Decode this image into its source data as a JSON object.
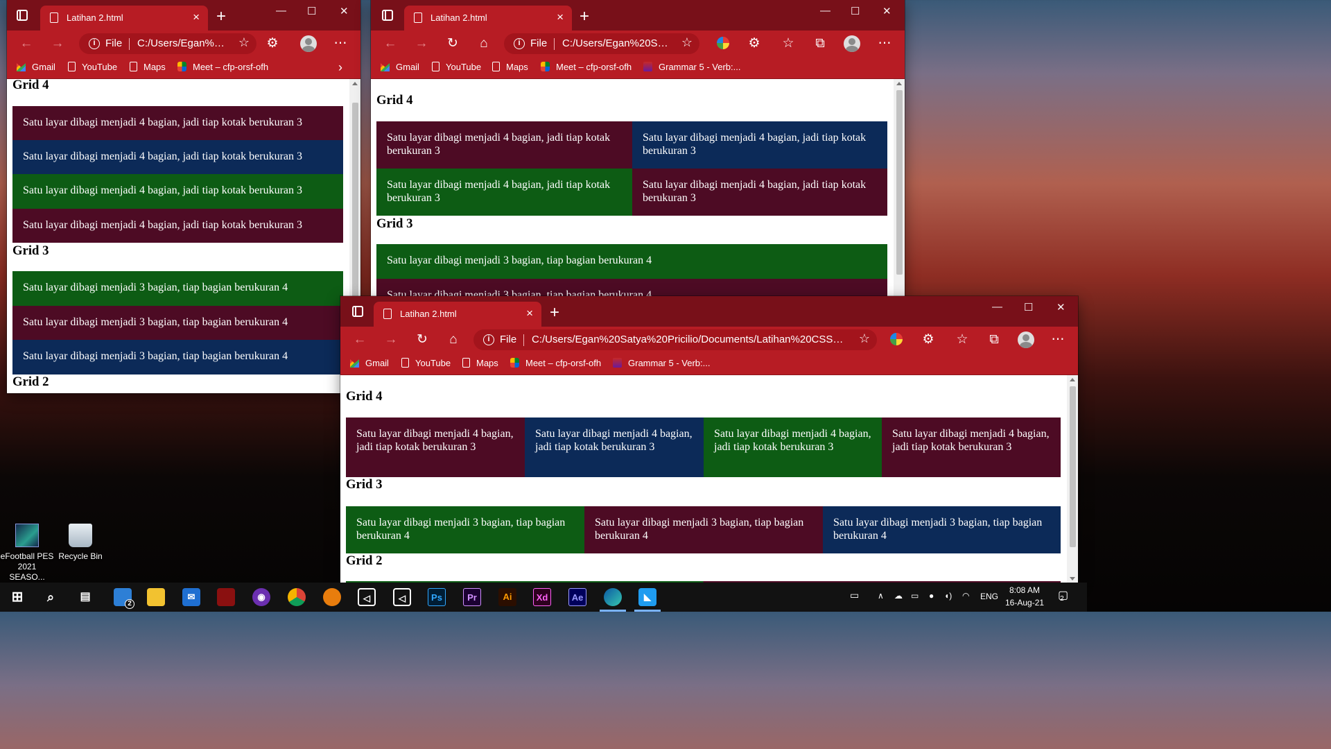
{
  "desktop": {
    "icons": [
      {
        "label_line1": "eFootball PES",
        "label_line2": "2021 SEASO..."
      },
      {
        "label_line1": "Recycle Bin",
        "label_line2": ""
      }
    ]
  },
  "browser": {
    "tab_title": "Latihan 2.html",
    "file_label": "File",
    "url_short": "C:/Users/Egan%2...",
    "url_medium": "C:/Users/Egan%20Saty...",
    "url_long": "C:/Users/Egan%20Satya%20Pricilio/Documents/Latihan%20CSS%20Re...",
    "bookmarks": [
      "Gmail",
      "YouTube",
      "Maps",
      "Meet – cfp-orsf-ofh",
      "Grammar 5 - Verb:..."
    ]
  },
  "page": {
    "heading_grid4": "Grid 4",
    "heading_grid3": "Grid 3",
    "heading_grid2": "Grid 2",
    "grid4_text": "Satu layar dibagi menjadi 4 bagian, jadi tiap kotak berukuran 3",
    "grid3_text": "Satu layar dibagi menjadi 3 bagian, tiap bagian berukuran 4"
  },
  "colors": {
    "maroon": "#4d0b24",
    "navy": "#0c2a58",
    "green": "#0d5c14",
    "edge_red": "#b71c24"
  },
  "taskbar": {
    "apps": [
      "Ps",
      "Pr",
      "Ai",
      "Xd",
      "Ae"
    ],
    "language": "ENG",
    "time": "8:08 AM",
    "date": "16-Aug-21",
    "notifications": "2",
    "task_badge": "2"
  }
}
